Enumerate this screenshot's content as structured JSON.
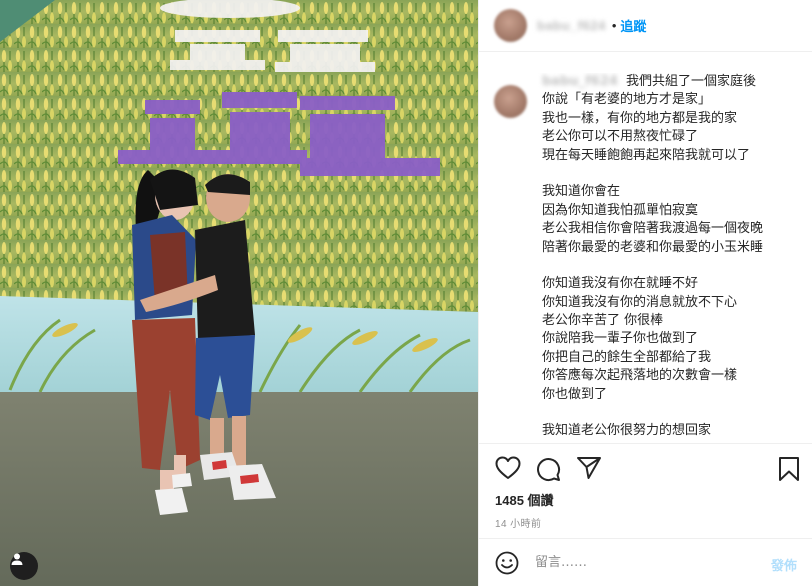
{
  "header": {
    "username": "babu_f624",
    "dot": "•",
    "follow_label": "追蹤",
    "more_label": "•••"
  },
  "caption": {
    "username": "babu_f624",
    "lines": [
      "我們共組了一個家庭後",
      "你說「有老婆的地方才是家」",
      "我也一樣，有你的地方都是我的家",
      "老公你可以不用熬夜忙碌了",
      "現在每天睡飽飽再起來陪我就可以了",
      "",
      "我知道你會在",
      "因為你知道我怕孤單怕寂寞",
      "老公我相信你會陪著我渡過每一個夜晚",
      "陪著你最愛的老婆和你最愛的小玉米睡",
      "",
      "你知道我沒有你在就睡不好",
      "你知道我沒有你的消息就放不下心",
      "老公你辛苦了 你很棒",
      "你說陪我一輩子你也做到了",
      "你把自己的餘生全部都給了我",
      "你答應每次起飛落地的次數會一樣",
      "你也做到了",
      "",
      "我知道老公你很努力的想回家"
    ]
  },
  "actions": {
    "like_icon": "heart-icon",
    "comment_icon": "comment-icon",
    "share_icon": "share-icon",
    "save_icon": "bookmark-icon"
  },
  "likes_text": "1485 個讚",
  "time_text": "14 小時前",
  "comment": {
    "placeholder": "留言……",
    "post_label": "發佈"
  }
}
